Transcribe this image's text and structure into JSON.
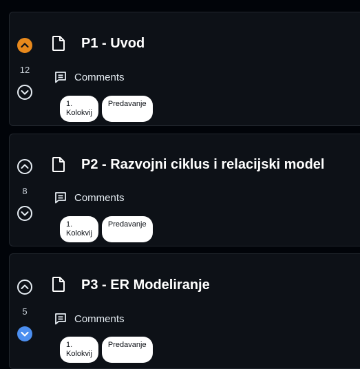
{
  "posts": [
    {
      "title": "P1 - Uvod",
      "votes": "12",
      "vote_state": "up",
      "comments_label": "Comments",
      "tags": [
        "1. Kolokvij",
        "Predavanje"
      ]
    },
    {
      "title": "P2 - Razvojni ciklus i relacijski model",
      "votes": "8",
      "vote_state": "none",
      "comments_label": "Comments",
      "tags": [
        "1. Kolokvij",
        "Predavanje"
      ]
    },
    {
      "title": "P3 - ER Modeliranje",
      "votes": "5",
      "vote_state": "down",
      "comments_label": "Comments",
      "tags": [
        "1. Kolokvij",
        "Predavanje"
      ]
    }
  ],
  "colors": {
    "upvote_active": "#e8891c",
    "downvote_active": "#4c8ff0",
    "neutral": "#e6edf3",
    "card_bg": "#0d1117",
    "page_bg": "#010409"
  },
  "icons": {
    "upvote": "chevron-up-circle-icon",
    "downvote": "chevron-down-circle-icon",
    "post": "document-icon",
    "comments": "comment-icon"
  }
}
